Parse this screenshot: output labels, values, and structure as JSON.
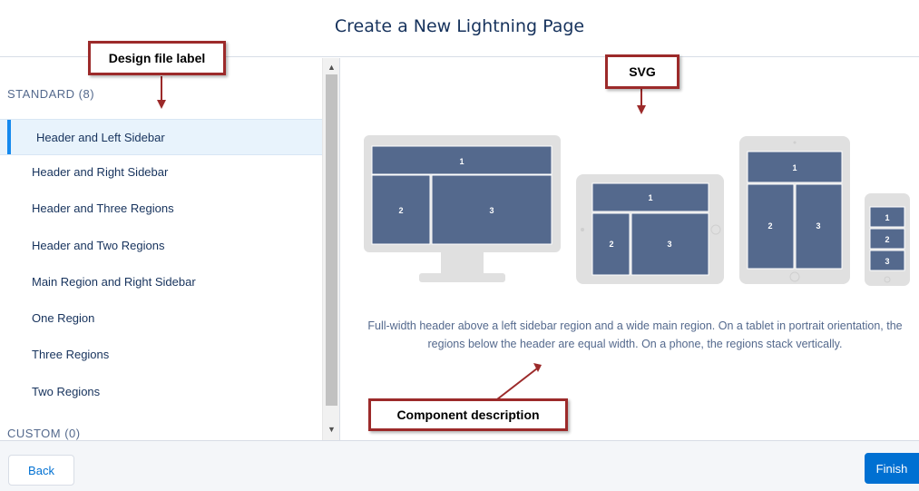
{
  "header": {
    "title": "Create a New Lightning Page"
  },
  "sidebar": {
    "standard_heading": "STANDARD (8)",
    "custom_heading": "CUSTOM (0)",
    "items": [
      {
        "label": "Header and Left Sidebar",
        "selected": true
      },
      {
        "label": "Header and Right Sidebar"
      },
      {
        "label": "Header and Three Regions"
      },
      {
        "label": "Header and Two Regions"
      },
      {
        "label": "Main Region and Right Sidebar"
      },
      {
        "label": "One Region"
      },
      {
        "label": "Three Regions"
      },
      {
        "label": "Two Regions"
      }
    ]
  },
  "preview": {
    "description": "Full-width header above a left sidebar region and a wide main region. On a tablet in portrait orientation, the regions below the header are equal width. On a phone, the regions stack vertically.",
    "region_labels": [
      "1",
      "2",
      "3"
    ]
  },
  "footer": {
    "back_label": "Back",
    "finish_label": "Finish"
  },
  "annotations": {
    "design_file_label": "Design file label",
    "svg": "SVG",
    "component_description": "Component description"
  },
  "colors": {
    "accent": "#1589ee",
    "primary_button": "#0070d2",
    "region_fill": "#54698d",
    "device_frame": "#e0e0e0",
    "callout_border": "#9c2a2a"
  }
}
